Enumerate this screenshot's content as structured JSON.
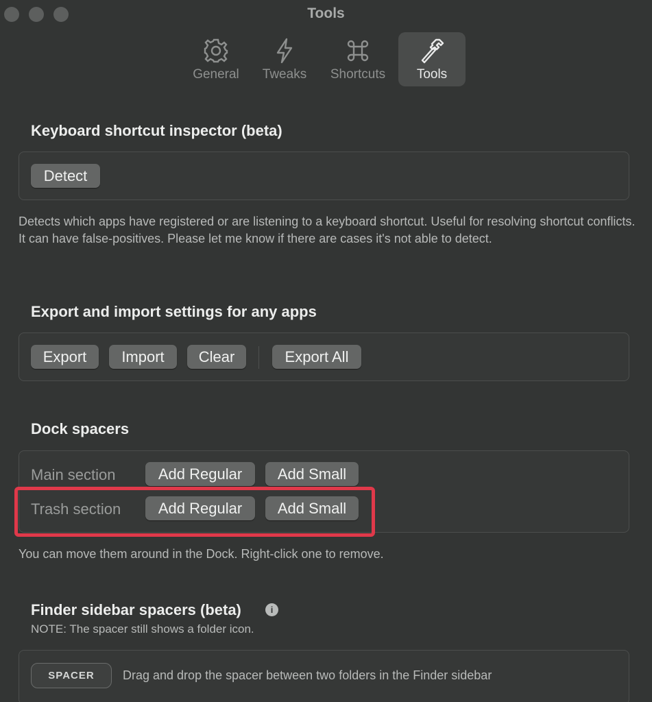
{
  "window": {
    "title": "Tools"
  },
  "tabs": [
    {
      "label": "General",
      "icon": "gear-icon"
    },
    {
      "label": "Tweaks",
      "icon": "bolt-icon"
    },
    {
      "label": "Shortcuts",
      "icon": "command-icon"
    },
    {
      "label": "Tools",
      "icon": "hammer-icon",
      "active": true
    }
  ],
  "shortcut_inspector": {
    "heading": "Keyboard shortcut inspector (beta)",
    "detect_label": "Detect",
    "description": "Detects which apps have registered or are listening to a keyboard shortcut. Useful for resolving shortcut conflicts. It can have false-positives. Please let me know if there are cases it's not able to detect."
  },
  "export_import": {
    "heading": "Export and import settings for any apps",
    "export_label": "Export",
    "import_label": "Import",
    "clear_label": "Clear",
    "export_all_label": "Export All"
  },
  "dock_spacers": {
    "heading": "Dock spacers",
    "main_label": "Main section",
    "trash_label": "Trash section",
    "add_regular_label": "Add Regular",
    "add_small_label": "Add Small",
    "description": "You can move them around in the Dock. Right-click one to remove."
  },
  "finder_spacers": {
    "heading": "Finder sidebar spacers (beta)",
    "note": "NOTE: The spacer still shows a folder icon.",
    "spacer_label": "SPACER",
    "instruction": "Drag and drop the spacer between two folders in the Finder sidebar",
    "info_glyph": "i"
  },
  "colors": {
    "background": "#333534",
    "button": "#646665",
    "highlight": "#e0394a"
  }
}
